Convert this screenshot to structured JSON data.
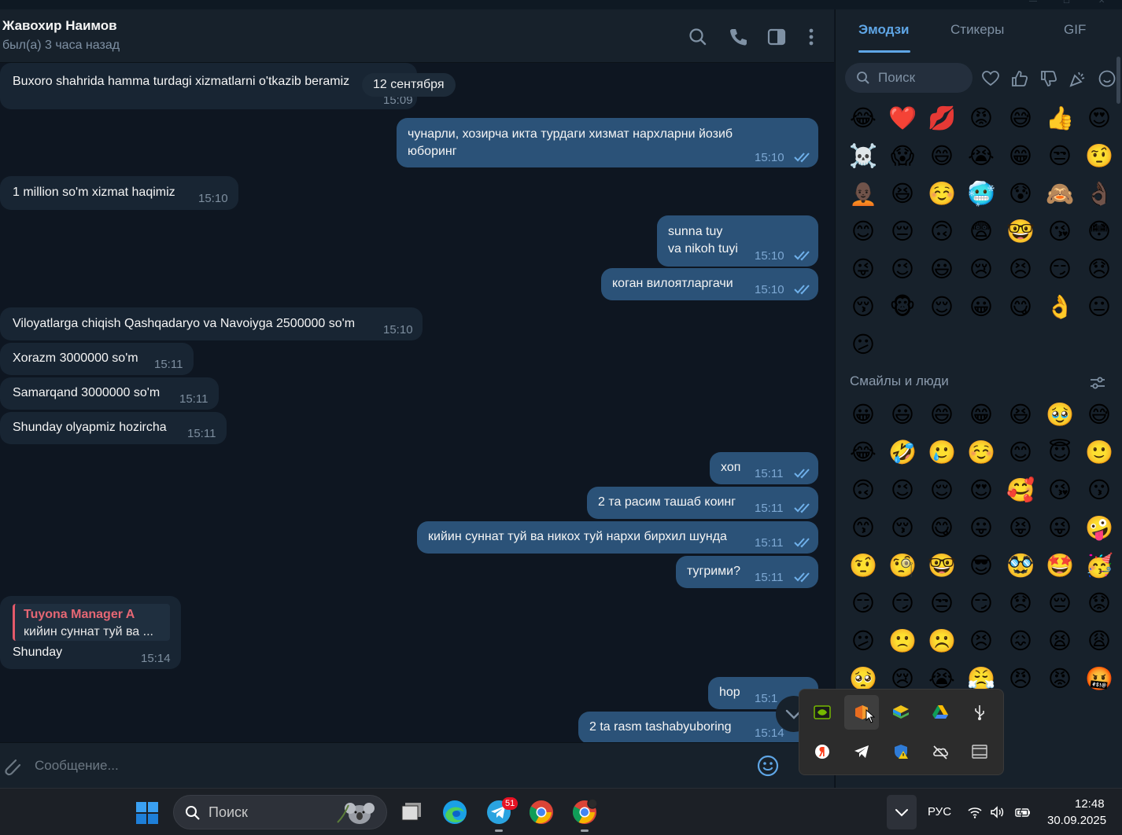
{
  "chat": {
    "contact_name": "Жавохир Наимов",
    "status": "был(а) 3 часа назад",
    "date_divider": "12 сентября",
    "messages": [
      {
        "text": "Buxoro shahrida hamma turdagi xizmatlarni o'tkazib beramiz",
        "time": "15:09",
        "dir": "in"
      },
      {
        "text": "чунарли, хозирча икта турдаги хизмат нархларни йозиб юборинг",
        "line1": "чунарли, хозирча икта турдаги хизмат нархларни йозиб",
        "line2": "юборинг",
        "time": "15:10",
        "dir": "out"
      },
      {
        "text": "1 million so'm xizmat haqimiz",
        "time": "15:10",
        "dir": "in"
      },
      {
        "line1": "sunna tuy",
        "line2": "va nikoh tuyi",
        "time": "15:10",
        "dir": "out"
      },
      {
        "text": "коган вилоятларгачи",
        "time": "15:10",
        "dir": "out"
      },
      {
        "text": "Viloyatlarga chiqish Qashqadaryo va Navoiyga 2500000 so'm",
        "time": "15:10",
        "dir": "in"
      },
      {
        "text": "Xorazm 3000000 so'm",
        "time": "15:11",
        "dir": "in"
      },
      {
        "text": "Samarqand 3000000 so'm",
        "time": "15:11",
        "dir": "in"
      },
      {
        "text": "Shunday olyapmiz hozircha",
        "time": "15:11",
        "dir": "in"
      },
      {
        "text": "хоп",
        "time": "15:11",
        "dir": "out"
      },
      {
        "text": "2 та расим ташаб коинг",
        "time": "15:11",
        "dir": "out"
      },
      {
        "text": "кийин суннат туй ва никох туй нархи бирхил шунда",
        "time": "15:11",
        "dir": "out"
      },
      {
        "text": "тугрими?",
        "time": "15:11",
        "dir": "out"
      },
      {
        "reply_name": "Tuyona Manager A",
        "reply_text": "кийин суннат туй ва ...",
        "text": "Shunday",
        "time": "15:14",
        "dir": "in"
      },
      {
        "text": "hop",
        "time": "15:1",
        "dir": "out"
      },
      {
        "text": "2 ta rasm tashabyuboring",
        "time": "15:14",
        "dir": "out"
      }
    ],
    "composer_placeholder": "Сообщение..."
  },
  "panel": {
    "tabs": [
      "Эмодзи",
      "Стикеры",
      "GIF"
    ],
    "search_placeholder": "Поиск",
    "section_title": "Смайлы и люди",
    "recent_emojis": [
      "😂",
      "❤️",
      "💋",
      "😡",
      "😅",
      "👍",
      "😍",
      "☠️",
      "😱",
      "😄",
      "😭",
      "😁",
      "😒",
      "🤨",
      "🧑🏿‍🦲",
      "😆",
      "☺️",
      "🥶",
      "😰",
      "🙈",
      "👌🏿",
      "😊",
      "😔",
      "🙃",
      "😨",
      "🤓",
      "😘",
      "😳",
      "😜",
      "😉",
      "😃",
      "😢",
      "😣",
      "😏",
      "😞",
      "😚",
      "🐵",
      "😌",
      "😀",
      "😋",
      "👌",
      "😐",
      "😕"
    ],
    "people_emojis": [
      "😀",
      "😃",
      "😄",
      "😁",
      "😆",
      "🥹",
      "😅",
      "😂",
      "🤣",
      "🥲",
      "☺️",
      "😊",
      "😇",
      "🙂",
      "🙃",
      "😉",
      "😌",
      "😍",
      "🥰",
      "😘",
      "😗",
      "😙",
      "😚",
      "😋",
      "😛",
      "😝",
      "😜",
      "🤪",
      "🤨",
      "🧐",
      "🤓",
      "😎",
      "🥸",
      "🤩",
      "🥳",
      "😏",
      "😏",
      "😒",
      "😏",
      "😞",
      "😔",
      "😟",
      "😕",
      "🙁",
      "☹️",
      "😣",
      "😖",
      "😫",
      "😩",
      "🥺",
      "😢",
      "😭",
      "😤",
      "😠",
      "😡",
      "🤬"
    ]
  },
  "tray": {
    "icons": [
      "nvidia-icon",
      "office-icon",
      "bluestacks-icon",
      "google-drive-icon",
      "usb-icon",
      "yandex-icon",
      "telegram-icon",
      "defender-warning-icon",
      "onedrive-offline-icon",
      "media-icon"
    ]
  },
  "taskbar": {
    "search_placeholder": "Поиск",
    "telegram_badge": "51",
    "language": "РУС",
    "time": "12:48",
    "date": "30.09.2025"
  }
}
